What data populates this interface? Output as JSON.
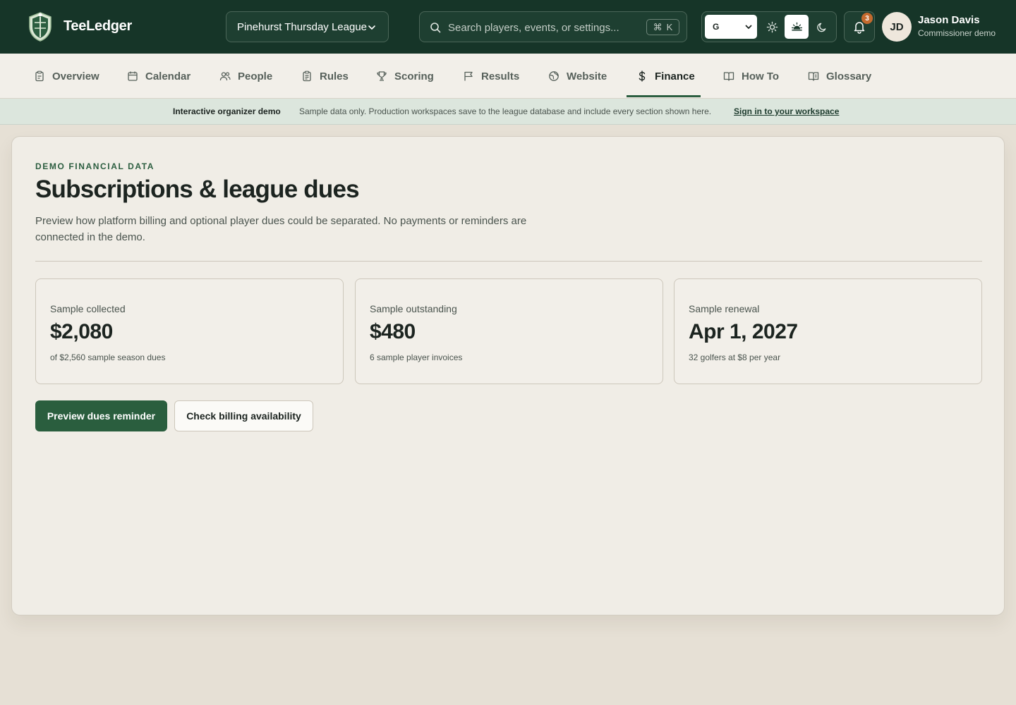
{
  "header": {
    "brand": "TeeLedger",
    "league_select": "Pinehurst Thursday League",
    "search": {
      "placeholder": "Search players, events, or settings...",
      "shortcut_mod": "⌘",
      "shortcut_key": "K"
    },
    "language": "G",
    "theme_modes": [
      "light",
      "sunrise",
      "dark"
    ],
    "active_theme": "sunrise",
    "notifications_count": "3",
    "user": {
      "initials": "JD",
      "name": "Jason Davis",
      "role": "Commissioner demo"
    }
  },
  "nav": {
    "tabs": [
      {
        "label": "Overview",
        "icon": "clipboard-icon"
      },
      {
        "label": "Calendar",
        "icon": "calendar-icon"
      },
      {
        "label": "People",
        "icon": "people-icon"
      },
      {
        "label": "Rules",
        "icon": "clipboard-list-icon"
      },
      {
        "label": "Scoring",
        "icon": "trophy-icon"
      },
      {
        "label": "Results",
        "icon": "flag-icon"
      },
      {
        "label": "Website",
        "icon": "globe-icon"
      },
      {
        "label": "Finance",
        "icon": "dollar-icon"
      },
      {
        "label": "How To",
        "icon": "book-icon"
      },
      {
        "label": "Glossary",
        "icon": "book-open-icon"
      }
    ],
    "active": "Finance"
  },
  "banner": {
    "title": "Interactive organizer demo",
    "text": "Sample data only. Production workspaces save to the league database and include every section shown here.",
    "link": "Sign in to your workspace"
  },
  "main": {
    "eyebrow": "DEMO FINANCIAL DATA",
    "title": "Subscriptions & league dues",
    "description": "Preview how platform billing and optional player dues could be separated. No payments or reminders are connected in the demo.",
    "stats": [
      {
        "label": "Sample collected",
        "value": "$2,080",
        "sub": "of $2,560 sample season dues"
      },
      {
        "label": "Sample outstanding",
        "value": "$480",
        "sub": "6 sample player invoices"
      },
      {
        "label": "Sample renewal",
        "value": "Apr 1, 2027",
        "sub": "32 golfers at $8 per year"
      }
    ],
    "primary_button": "Preview dues reminder",
    "secondary_button": "Check billing availability"
  },
  "colors": {
    "header_bg": "#163528",
    "accent": "#2a5e3e",
    "badge": "#c46a2e",
    "page_bg": "#e6e0d5"
  }
}
